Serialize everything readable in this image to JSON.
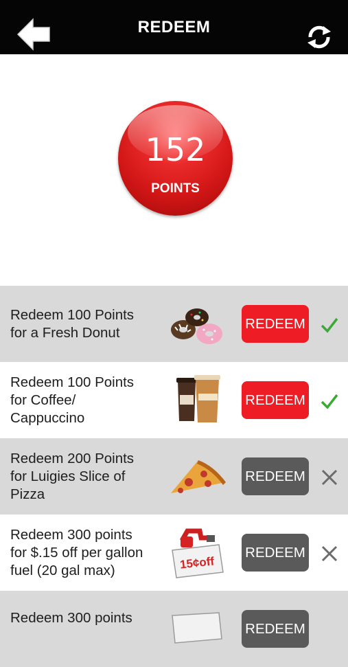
{
  "header": {
    "title": "REDEEM",
    "back_icon": "back-arrow-icon",
    "refresh_icon": "refresh-icon"
  },
  "points": {
    "value": "152",
    "label": "POINTS"
  },
  "rewards": [
    {
      "line1": "Redeem 100 Points",
      "line2": "for a Fresh Donut",
      "line3": "",
      "button": "REDEEM",
      "image": "donuts-image",
      "status": "available"
    },
    {
      "line1": "Redeem 100 Points",
      "line2": "for Coffee/",
      "line3": "Cappuccino",
      "button": "REDEEM",
      "image": "coffee-cups-image",
      "status": "available"
    },
    {
      "line1": "Redeem 200 Points",
      "line2": "for Luigies Slice of",
      "line3": "Pizza",
      "button": "REDEEM",
      "image": "pizza-slice-image",
      "status": "unavailable"
    },
    {
      "line1": "Redeem 300 points",
      "line2": "for $.15 off per gallon",
      "line3": "fuel (20 gal max)",
      "button": "REDEEM",
      "image": "fuel-discount-image",
      "image_text": "15¢off",
      "status": "unavailable"
    },
    {
      "line1": "Redeem 300 points",
      "line2": "",
      "line3": "",
      "button": "REDEEM",
      "image": "fuel-discount-image",
      "status": "unavailable"
    }
  ],
  "colors": {
    "header_bg": "#050505",
    "redeem_active": "#ee1c25",
    "redeem_inactive": "#5a5a5a",
    "check": "#3aaa35",
    "cross": "#6b6b6b",
    "row_alt": "#d9d9d9"
  }
}
